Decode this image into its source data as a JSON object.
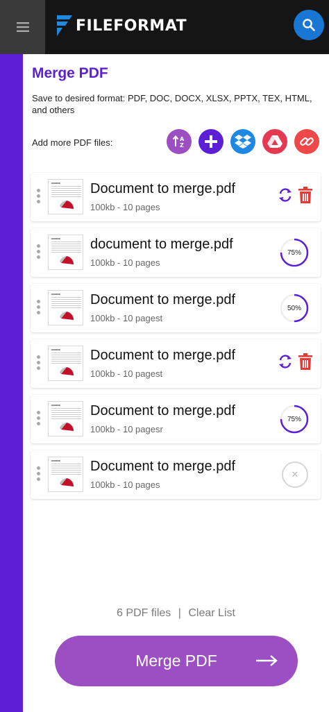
{
  "header": {
    "brand": "FILEFORMAT",
    "menu_icon": "hamburger-menu-icon",
    "search_icon": "search-icon"
  },
  "main": {
    "title": "Merge PDF",
    "subtitle": "Save to desired format: PDF, DOC, DOCX, XLSX, PPTX, TEX, HTML, and others",
    "add_label": "Add more PDF files:",
    "add_sources": [
      {
        "name": "sort-icon",
        "color": "#9b4fc2"
      },
      {
        "name": "add-icon",
        "color": "#5c1fd6"
      },
      {
        "name": "dropbox-icon",
        "color": "#1e88e5"
      },
      {
        "name": "google-drive-icon",
        "color": "#e53952"
      },
      {
        "name": "link-icon",
        "color": "#f04848"
      }
    ]
  },
  "files": [
    {
      "name": "Document to merge.pdf",
      "meta": "100kb - 10 pages",
      "status": "done"
    },
    {
      "name": "document to merge.pdf",
      "meta": "100kb - 10 pages",
      "status": "uploading",
      "progress_label": "75%",
      "progress": 0.75
    },
    {
      "name": "Document to merge.pdf",
      "meta": "100kb - 10 pagest",
      "status": "uploading",
      "progress_label": "50%",
      "progress": 0.5
    },
    {
      "name": "Document to merge.pdf",
      "meta": "100kb - 10 pagest",
      "status": "done"
    },
    {
      "name": "Document to merge.pdf",
      "meta": "100kb - 10 pagesr",
      "status": "uploading",
      "progress_label": "75%",
      "progress": 0.75
    },
    {
      "name": "Document to merge.pdf",
      "meta": "100kb - 10 pages",
      "status": "queued"
    }
  ],
  "footer": {
    "count": "6 PDF files",
    "separator": "|",
    "clear": "Clear List",
    "merge_button": "Merge PDF"
  },
  "colors": {
    "accent": "#5c1fd6",
    "button": "#9b4fc2",
    "delete": "#e53935",
    "header": "#151515"
  }
}
